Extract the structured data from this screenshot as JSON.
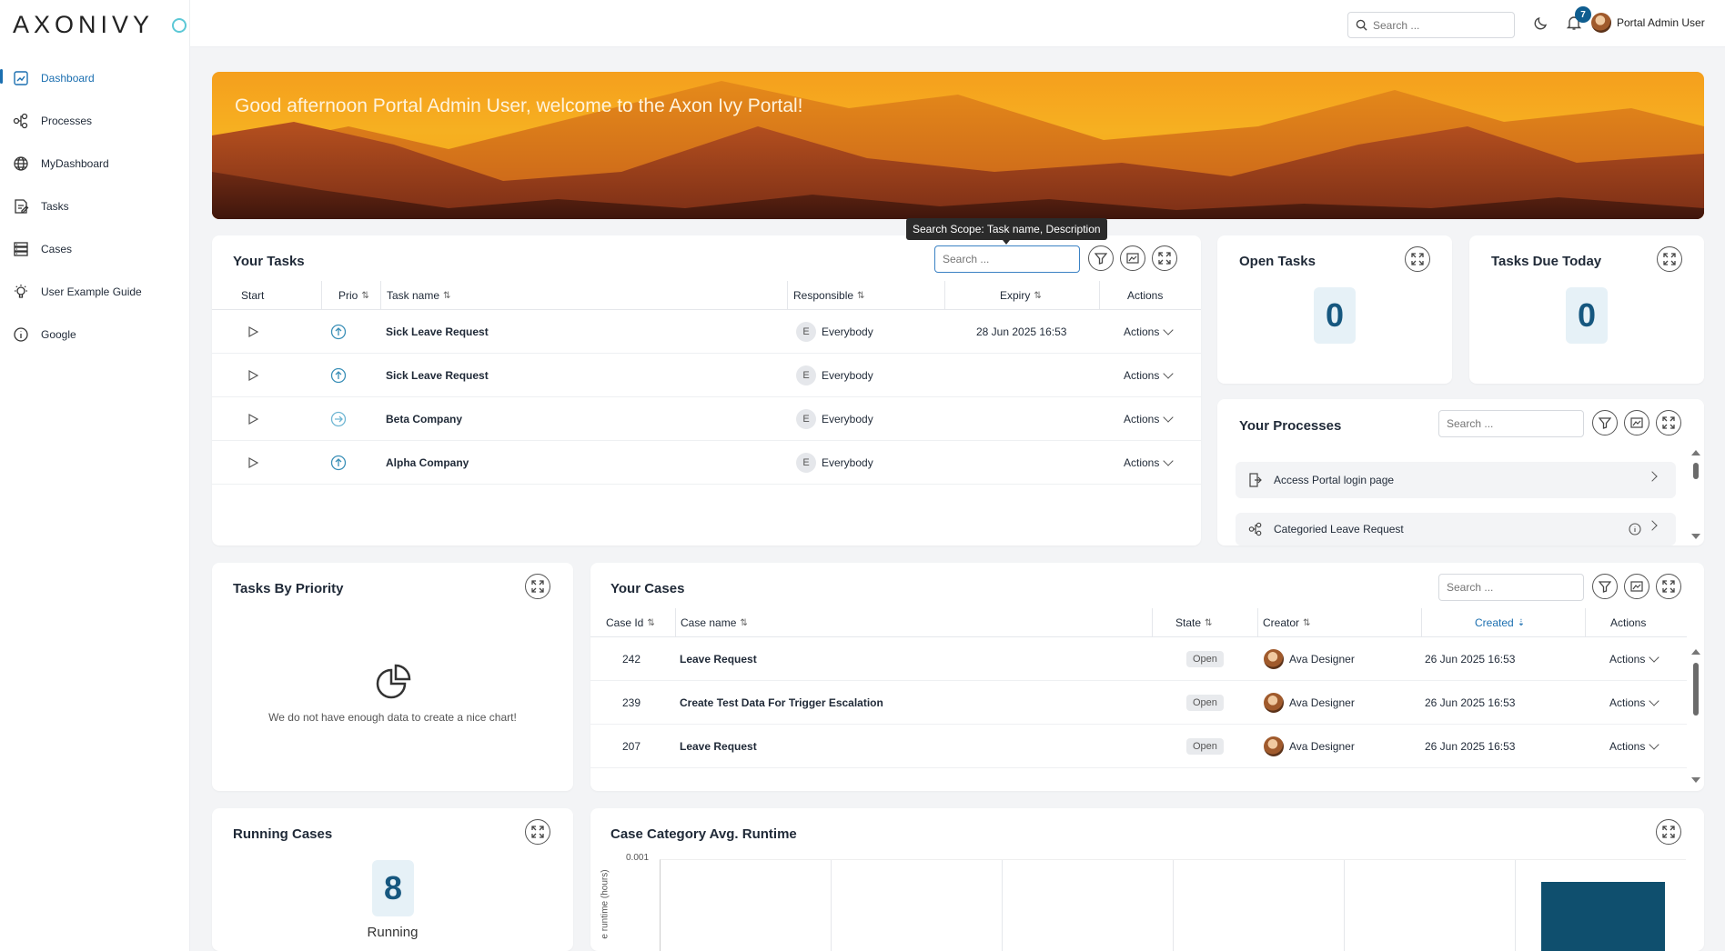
{
  "app": {
    "logo": "AXONIVY"
  },
  "sidebar": {
    "items": [
      {
        "label": "Dashboard",
        "icon": "dashboard-icon",
        "active": true
      },
      {
        "label": "Processes",
        "icon": "processes-icon"
      },
      {
        "label": "MyDashboard",
        "icon": "globe-icon"
      },
      {
        "label": "Tasks",
        "icon": "tasks-icon"
      },
      {
        "label": "Cases",
        "icon": "cases-icon"
      },
      {
        "label": "User Example Guide",
        "icon": "lightbulb-icon"
      },
      {
        "label": "Google",
        "icon": "info-icon"
      }
    ]
  },
  "topbar": {
    "search_placeholder": "Search ...",
    "notification_count": "7",
    "user_name": "Portal Admin User"
  },
  "banner": {
    "greeting": "Good afternoon Portal Admin User, welcome to the Axon Ivy Portal!"
  },
  "tasks": {
    "title": "Your Tasks",
    "search_placeholder": "Search ...",
    "tooltip": "Search Scope: Task name, Description",
    "columns": {
      "start": "Start",
      "prio": "Prio",
      "name": "Task name",
      "responsible": "Responsible",
      "expiry": "Expiry",
      "actions": "Actions"
    },
    "rows": [
      {
        "name": "Sick Leave Request",
        "responsible_initial": "E",
        "responsible": "Everybody",
        "expiry": "28 Jun 2025 16:53",
        "actions": "Actions"
      },
      {
        "name": "Sick Leave Request",
        "responsible_initial": "E",
        "responsible": "Everybody",
        "expiry": "",
        "actions": "Actions"
      },
      {
        "name": "Beta Company",
        "responsible_initial": "E",
        "responsible": "Everybody",
        "expiry": "",
        "actions": "Actions"
      },
      {
        "name": "Alpha Company",
        "responsible_initial": "E",
        "responsible": "Everybody",
        "expiry": "",
        "actions": "Actions"
      }
    ]
  },
  "open_tasks": {
    "title": "Open Tasks",
    "value": "0"
  },
  "tasks_due": {
    "title": "Tasks Due Today",
    "value": "0"
  },
  "processes": {
    "title": "Your Processes",
    "search_placeholder": "Search ...",
    "items": [
      {
        "label": "Access Portal login page"
      },
      {
        "label": "Categoried Leave Request"
      }
    ]
  },
  "priority": {
    "title": "Tasks By Priority",
    "empty_text": "We do not have enough data to create a nice chart!"
  },
  "cases": {
    "title": "Your Cases",
    "search_placeholder": "Search ...",
    "columns": {
      "id": "Case Id",
      "name": "Case name",
      "state": "State",
      "creator": "Creator",
      "created": "Created",
      "actions": "Actions"
    },
    "rows": [
      {
        "id": "242",
        "name": "Leave Request",
        "state": "Open",
        "creator": "Ava Designer",
        "created": "26 Jun 2025 16:53",
        "actions": "Actions"
      },
      {
        "id": "239",
        "name": "Create Test Data For Trigger Escalation",
        "state": "Open",
        "creator": "Ava Designer",
        "created": "26 Jun 2025 16:53",
        "actions": "Actions"
      },
      {
        "id": "207",
        "name": "Leave Request",
        "state": "Open",
        "creator": "Ava Designer",
        "created": "26 Jun 2025 16:53",
        "actions": "Actions"
      }
    ]
  },
  "running": {
    "title": "Running Cases",
    "value": "8",
    "label": "Running"
  },
  "runtime": {
    "title": "Case Category Avg. Runtime",
    "ylabel": "e runtime (hours)",
    "ytick": "0.001"
  },
  "colors": {
    "accent": "#16577f",
    "active_nav": "#1b6fb0",
    "bar": "#0f4f6e"
  }
}
